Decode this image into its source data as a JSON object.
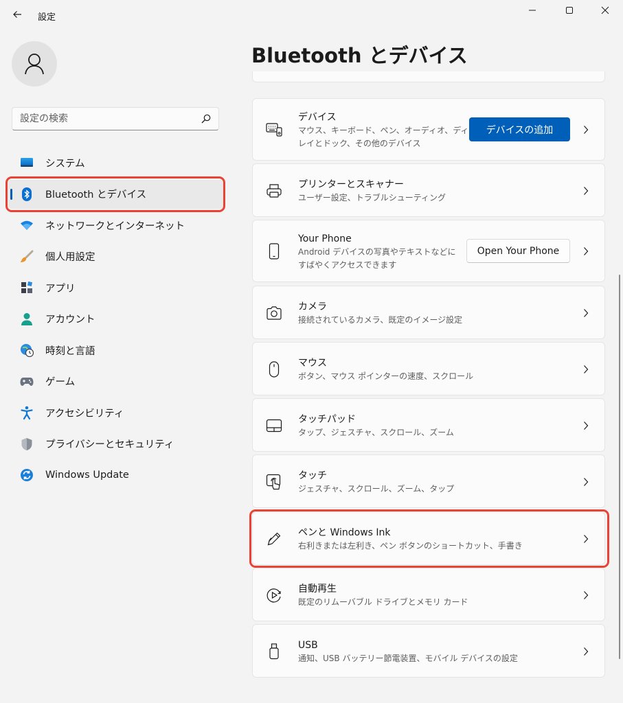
{
  "window": {
    "title": "設定",
    "minimize_icon": "minimize-icon",
    "maximize_icon": "maximize-icon",
    "close_icon": "close-icon"
  },
  "search": {
    "placeholder": "設定の検索",
    "value": ""
  },
  "sidebar": {
    "items": [
      {
        "label": "システム",
        "icon": "system-icon",
        "active": false
      },
      {
        "label": "Bluetooth とデバイス",
        "icon": "bluetooth-icon",
        "active": true
      },
      {
        "label": "ネットワークとインターネット",
        "icon": "network-icon",
        "active": false
      },
      {
        "label": "個人用設定",
        "icon": "brush-icon",
        "active": false
      },
      {
        "label": "アプリ",
        "icon": "apps-icon",
        "active": false
      },
      {
        "label": "アカウント",
        "icon": "account-icon",
        "active": false
      },
      {
        "label": "時刻と言語",
        "icon": "time-language-icon",
        "active": false
      },
      {
        "label": "ゲーム",
        "icon": "gamepad-icon",
        "active": false
      },
      {
        "label": "アクセシビリティ",
        "icon": "accessibility-icon",
        "active": false
      },
      {
        "label": "プライバシーとセキュリティ",
        "icon": "shield-icon",
        "active": false
      },
      {
        "label": "Windows Update",
        "icon": "update-icon",
        "active": false
      }
    ]
  },
  "main": {
    "title": "Bluetooth とデバイス",
    "cards": [
      {
        "title": "デバイス",
        "desc1": "マウス、キーボード、ペン、オーディオ、ディスプ",
        "desc2": "レイとドック、その他のデバイス",
        "button": "デバイスの追加",
        "icon": "devices-icon"
      },
      {
        "title": "プリンターとスキャナー",
        "desc1": "ユーザー設定、トラブルシューティング",
        "icon": "printer-icon"
      },
      {
        "title": "Your Phone",
        "desc1": "Android デバイスの写真やテキストなどに",
        "desc2": "すばやくアクセスできます",
        "button": "Open Your Phone",
        "icon": "phone-icon"
      },
      {
        "title": "カメラ",
        "desc1": "接続されているカメラ、既定のイメージ設定",
        "icon": "camera-icon"
      },
      {
        "title": "マウス",
        "desc1": "ボタン、マウス ポインターの速度、スクロール",
        "icon": "mouse-icon"
      },
      {
        "title": "タッチパッド",
        "desc1": "タップ、ジェスチャ、スクロール、ズーム",
        "icon": "touchpad-icon"
      },
      {
        "title": "タッチ",
        "desc1": "ジェスチャ、スクロール、ズーム、タップ",
        "icon": "touch-icon"
      },
      {
        "title": "ペンと Windows Ink",
        "desc1": "右利きまたは左利き、ペン ボタンのショートカット、手書き",
        "icon": "pen-icon"
      },
      {
        "title": "自動再生",
        "desc1": "既定のリムーバブル ドライブとメモリ カード",
        "icon": "autoplay-icon"
      },
      {
        "title": "USB",
        "desc1": "通知、USB バッテリー節電装置、モバイル デバイスの設定",
        "icon": "usb-icon"
      }
    ]
  },
  "colors": {
    "accent": "#005fb8",
    "highlight": "#ea4335",
    "background": "#f3f3f3",
    "card": "#fbfbfb"
  }
}
